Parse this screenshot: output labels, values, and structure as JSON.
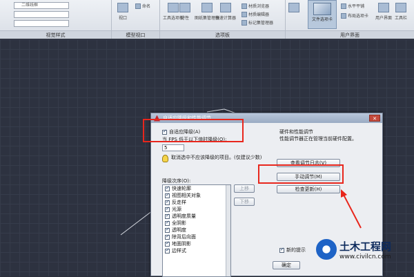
{
  "ribbon": {
    "combo_value": "二维线框",
    "combo2_value": "",
    "panel_labels": [
      "视觉样式",
      "模型视口",
      "选项板",
      "用户界面"
    ],
    "buttons": {
      "viewport_config": "视口",
      "named": "命名",
      "tool_palette": "工具选项板",
      "properties": "特性",
      "sheet_set": "图纸集管理器",
      "calc": "快速计算器",
      "markup": "标记集管理器",
      "material_browser": "材质浏览器",
      "material_editor": "材质编辑器",
      "render": "",
      "file_tabs": "文件选项卡",
      "horizontal_tile": "水平平铺",
      "layout_tabs": "布局选项卡",
      "user_interface": "用户界面",
      "toolbar": "工具栏"
    }
  },
  "dialog": {
    "title": "自适应降级和性能调节",
    "adaptive_degradation_label": "自适应降级(A)",
    "adaptive_degradation_checked": true,
    "fps_label": "当 FPS 低于以下值时降级(Q):",
    "fps_value": "5",
    "hint": "取消选中不应该降级的项目。(仅建议少数)",
    "order_label": "降级次序(O):",
    "order_items": [
      {
        "label": "快速轮廓",
        "checked": true
      },
      {
        "label": "视图相关对象",
        "checked": true
      },
      {
        "label": "反走样",
        "checked": true
      },
      {
        "label": "光源",
        "checked": true
      },
      {
        "label": "透明度质量",
        "checked": true
      },
      {
        "label": "全阴影",
        "checked": true
      },
      {
        "label": "透明度",
        "checked": true
      },
      {
        "label": "除背后向面",
        "checked": true
      },
      {
        "label": "地面阴影",
        "checked": true
      },
      {
        "label": "边样式",
        "checked": true
      }
    ],
    "move_up": "上移",
    "move_down": "下移",
    "hw_title": "硬件和性能调节",
    "hw_desc": "性能调节器正在管理当前硬件配置。",
    "view_log": "查看调节日志(V)",
    "manual_tune": "手动调节(M)",
    "check_update": "检查更新(H)",
    "new_hint_label": "新的提示",
    "new_hint_checked": true,
    "ok": "确定"
  },
  "watermark": {
    "text": "土木工程网",
    "url": "www.civilcn.com"
  },
  "colors": {
    "highlight_red": "#e8261c",
    "canvas": "#2d3240"
  }
}
